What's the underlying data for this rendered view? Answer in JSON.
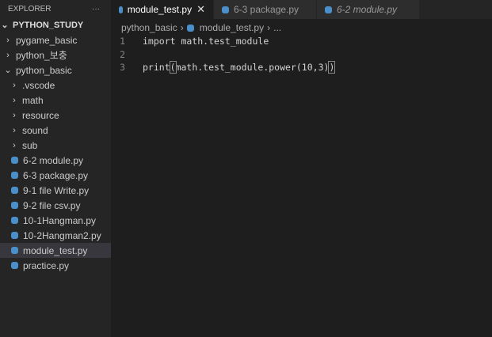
{
  "explorer": {
    "title": "EXPLORER",
    "more": "···",
    "root": "PYTHON_STUDY",
    "items": [
      {
        "label": "pygame_basic",
        "type": "folder",
        "depth": 1,
        "open": false
      },
      {
        "label": "python_보충",
        "type": "folder",
        "depth": 1,
        "open": false
      },
      {
        "label": "python_basic",
        "type": "folder",
        "depth": 1,
        "open": true
      },
      {
        "label": ".vscode",
        "type": "folder",
        "depth": 2,
        "open": false
      },
      {
        "label": "math",
        "type": "folder",
        "depth": 2,
        "open": false
      },
      {
        "label": "resource",
        "type": "folder",
        "depth": 2,
        "open": false
      },
      {
        "label": "sound",
        "type": "folder",
        "depth": 2,
        "open": false
      },
      {
        "label": "sub",
        "type": "folder",
        "depth": 2,
        "open": false
      },
      {
        "label": "6-2 module.py",
        "type": "file",
        "depth": 2
      },
      {
        "label": "6-3 package.py",
        "type": "file",
        "depth": 2
      },
      {
        "label": "9-1 file Write.py",
        "type": "file",
        "depth": 2
      },
      {
        "label": "9-2 file csv.py",
        "type": "file",
        "depth": 2
      },
      {
        "label": "10-1Hangman.py",
        "type": "file",
        "depth": 2
      },
      {
        "label": "10-2Hangman2.py",
        "type": "file",
        "depth": 2
      },
      {
        "label": "module_test.py",
        "type": "file",
        "depth": 2,
        "selected": true
      },
      {
        "label": "practice.py",
        "type": "file",
        "depth": 2
      }
    ]
  },
  "tabs": [
    {
      "label": "module_test.py",
      "active": true,
      "close": "✕"
    },
    {
      "label": "6-3 package.py"
    },
    {
      "label": "6-2 module.py",
      "italic": true
    }
  ],
  "breadcrumb": {
    "folder": "python_basic",
    "sep": "›",
    "file": "module_test.py",
    "more": "..."
  },
  "code": [
    {
      "n": "1",
      "pre": "import math.test_module",
      "b1": "",
      "mid": "",
      "b2": ""
    },
    {
      "n": "2",
      "pre": "",
      "b1": "",
      "mid": "",
      "b2": ""
    },
    {
      "n": "3",
      "pre": "print",
      "b1": "(",
      "mid": "math.test_module.power(10,3)",
      "b2": ")"
    }
  ]
}
